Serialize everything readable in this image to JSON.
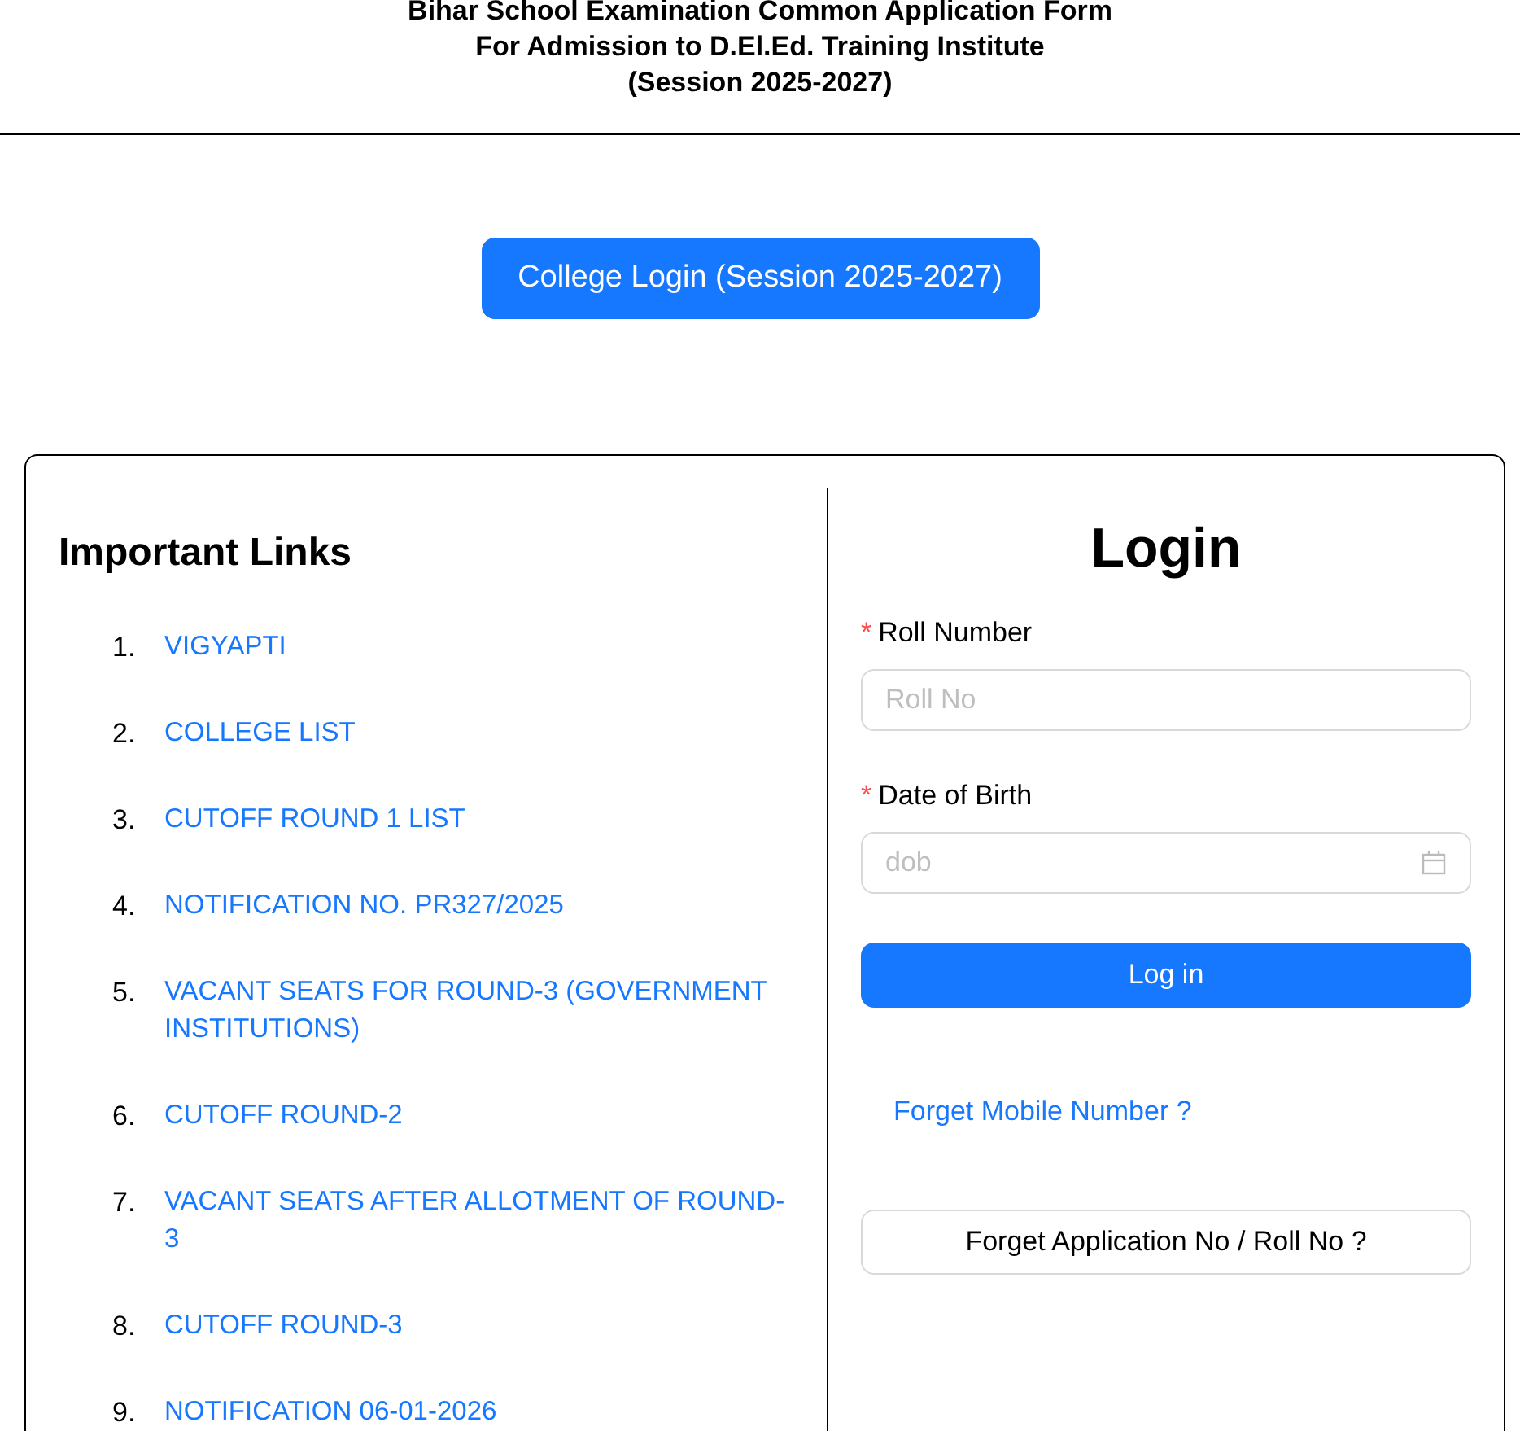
{
  "header": {
    "title_lines": [
      "Bihar School Examination Common Application Form",
      "For Admission to D.El.Ed. Training Institute",
      "(Session 2025-2027)"
    ]
  },
  "college_login_button": "College Login (Session 2025-2027)",
  "important_links": {
    "heading": "Important Links",
    "items": [
      {
        "number": "1.",
        "label": "VIGYAPTI"
      },
      {
        "number": "2.",
        "label": "COLLEGE LIST"
      },
      {
        "number": "3.",
        "label": "CUTOFF ROUND 1 LIST"
      },
      {
        "number": "4.",
        "label": "NOTIFICATION NO. PR327/2025"
      },
      {
        "number": "5.",
        "label": "VACANT SEATS FOR ROUND-3 (GOVERNMENT INSTITUTIONS)"
      },
      {
        "number": "6.",
        "label": "CUTOFF ROUND-2"
      },
      {
        "number": "7.",
        "label": "VACANT SEATS AFTER ALLOTMENT OF ROUND-3"
      },
      {
        "number": "8.",
        "label": "CUTOFF ROUND-3"
      },
      {
        "number": "9.",
        "label": "NOTIFICATION 06-01-2026"
      }
    ]
  },
  "login": {
    "heading": "Login",
    "fields": [
      {
        "label": "Roll Number",
        "required_mark": "*",
        "placeholder": "Roll No",
        "kind": "text"
      },
      {
        "label": "Date of Birth",
        "required_mark": "*",
        "placeholder": "dob",
        "kind": "date"
      }
    ],
    "submit": "Log in",
    "forget_mobile_link": "Forget Mobile Number ?",
    "forget_application_button": "Forget Application No / Roll No ?"
  }
}
